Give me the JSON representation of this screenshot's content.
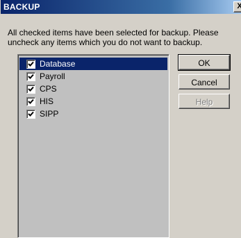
{
  "window": {
    "title": "BACKUP",
    "close_label": "X"
  },
  "message": "All checked items have been selected for backup.  Please\nuncheck any items which you do not want to backup.",
  "items": [
    {
      "label": "Database",
      "checked": true,
      "selected": true
    },
    {
      "label": "Payroll",
      "checked": true,
      "selected": false
    },
    {
      "label": "CPS",
      "checked": true,
      "selected": false
    },
    {
      "label": "HIS",
      "checked": true,
      "selected": false
    },
    {
      "label": "SIPP",
      "checked": true,
      "selected": false
    }
  ],
  "buttons": {
    "ok": "OK",
    "cancel": "Cancel",
    "help": "Help"
  },
  "colors": {
    "titlebar": "#0a246a",
    "selection": "#0a246a",
    "dialog": "#d4d0c8",
    "list_bg": "#c0c0c0"
  }
}
